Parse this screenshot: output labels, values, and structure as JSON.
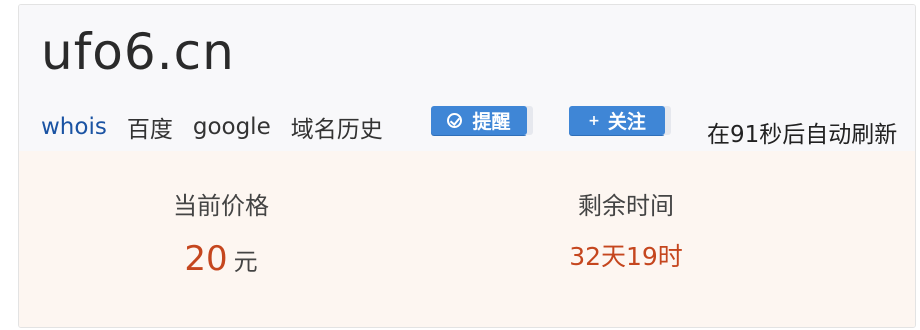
{
  "domain": "ufo6.cn",
  "links": {
    "whois": "whois",
    "baidu": "百度",
    "google": "google",
    "history": "域名历史"
  },
  "buttons": {
    "remind": "提醒",
    "follow": "关注"
  },
  "refresh_text": "在91秒后自动刷新",
  "price": {
    "label": "当前价格",
    "value": "20",
    "unit": "元"
  },
  "time_left": {
    "label": "剩余时间",
    "value": "32天19时"
  },
  "colors": {
    "accent": "#3f86d6",
    "link": "#1a53a3",
    "highlight": "#c5461e"
  },
  "icons": [
    "check-circle-icon",
    "plus-icon"
  ]
}
